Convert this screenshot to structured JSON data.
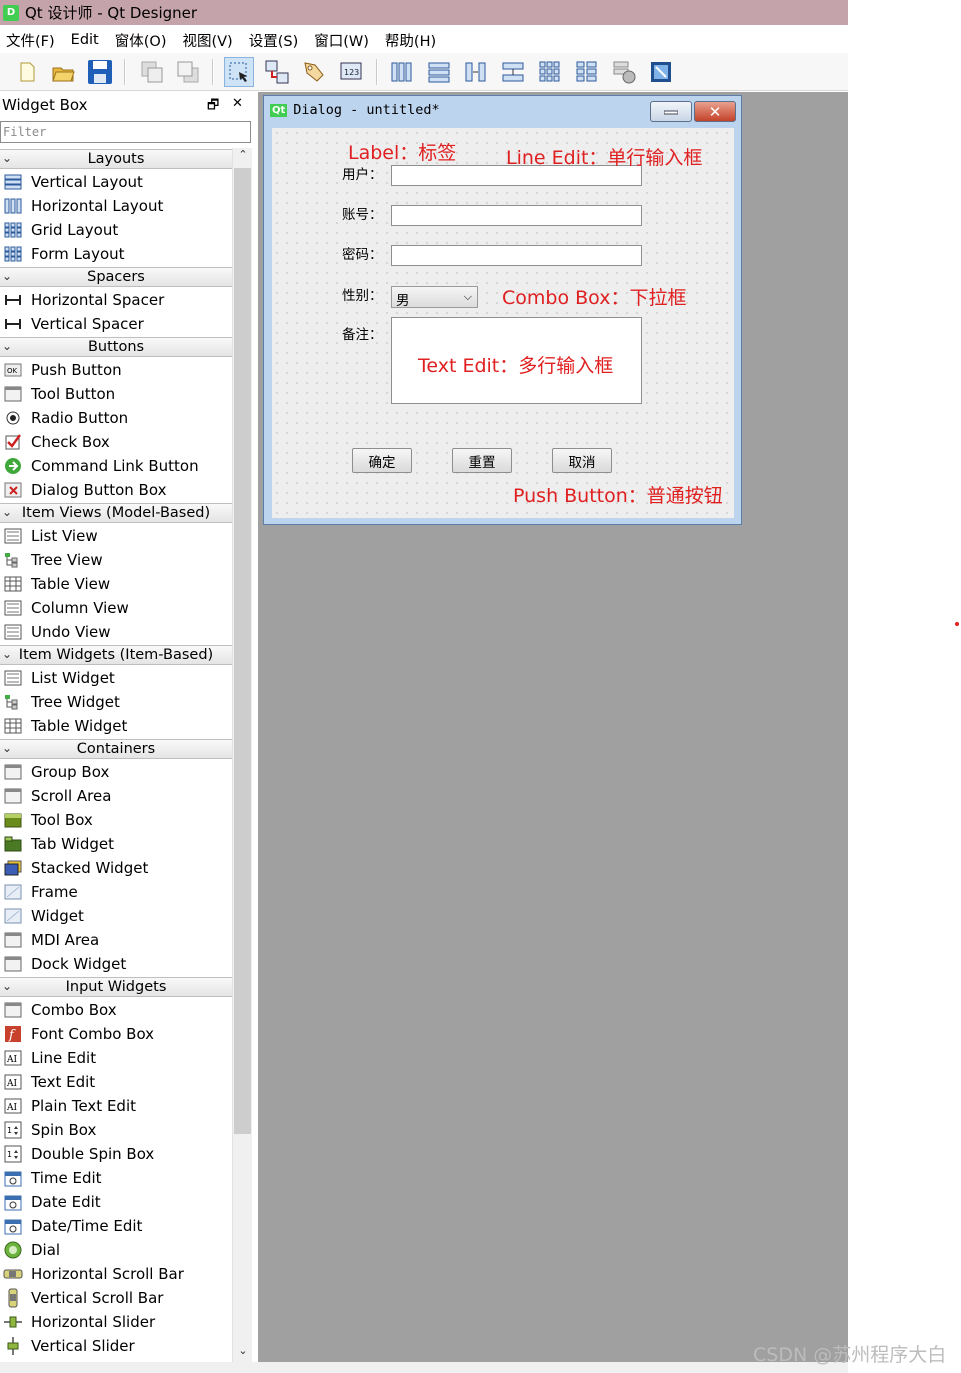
{
  "window": {
    "title": "Qt 设计师 - Qt Designer"
  },
  "menubar": [
    "文件(F)",
    "Edit",
    "窗体(O)",
    "视图(V)",
    "设置(S)",
    "窗口(W)",
    "帮助(H)"
  ],
  "toolbar": {
    "icons": [
      "new-file-icon",
      "open-folder-icon",
      "save-icon",
      "send-to-back-icon",
      "bring-to-front-icon",
      "edit-widgets-icon",
      "edit-signals-slots-icon",
      "edit-buddies-icon",
      "edit-tab-order-icon",
      "layout-horizontal-icon",
      "layout-vertical-icon",
      "layout-horizontal-splitter-icon",
      "layout-vertical-splitter-icon",
      "layout-grid-icon",
      "layout-form-icon",
      "break-layout-icon",
      "adjust-size-icon"
    ]
  },
  "widget_box": {
    "title": "Widget Box",
    "float_glyph": "🗗",
    "close_glyph": "✕",
    "filter_placeholder": "Filter",
    "groups": [
      {
        "name": "Layouts",
        "items": [
          "Vertical Layout",
          "Horizontal Layout",
          "Grid Layout",
          "Form Layout"
        ]
      },
      {
        "name": "Spacers",
        "items": [
          "Horizontal Spacer",
          "Vertical Spacer"
        ]
      },
      {
        "name": "Buttons",
        "items": [
          "Push Button",
          "Tool Button",
          "Radio Button",
          "Check Box",
          "Command Link Button",
          "Dialog Button Box"
        ]
      },
      {
        "name": "Item Views (Model-Based)",
        "items": [
          "List View",
          "Tree View",
          "Table View",
          "Column View",
          "Undo View"
        ]
      },
      {
        "name": "Item Widgets (Item-Based)",
        "items": [
          "List Widget",
          "Tree Widget",
          "Table Widget"
        ]
      },
      {
        "name": "Containers",
        "items": [
          "Group Box",
          "Scroll Area",
          "Tool Box",
          "Tab Widget",
          "Stacked Widget",
          "Frame",
          "Widget",
          "MDI Area",
          "Dock Widget"
        ]
      },
      {
        "name": "Input Widgets",
        "items": [
          "Combo Box",
          "Font Combo Box",
          "Line Edit",
          "Text Edit",
          "Plain Text Edit",
          "Spin Box",
          "Double Spin Box",
          "Time Edit",
          "Date Edit",
          "Date/Time Edit",
          "Dial",
          "Horizontal Scroll Bar",
          "Vertical Scroll Bar",
          "Horizontal Slider",
          "Vertical Slider"
        ]
      }
    ]
  },
  "dialog": {
    "title": "Dialog - untitled*",
    "qt_badge": "Qt",
    "labels": {
      "user": "用户：",
      "account": "账号：",
      "password": "密码：",
      "gender": "性别：",
      "remark": "备注："
    },
    "combo_value": "男",
    "buttons": {
      "ok": "确定",
      "reset": "重置",
      "cancel": "取消"
    }
  },
  "annotations": {
    "label": "Label：标签",
    "line_edit": "Line Edit：单行输入框",
    "combo_box": "Combo Box：下拉框",
    "text_edit": "Text Edit：多行输入框",
    "push_button": "Push Button：普通按钮"
  },
  "watermark": "CSDN @苏州程序大白",
  "colors": {
    "annotation": "#e02020",
    "title_bar": "#c4a3ab",
    "designer_bg": "#a0a0a0",
    "dialog_frame": "#bcd4ee"
  }
}
